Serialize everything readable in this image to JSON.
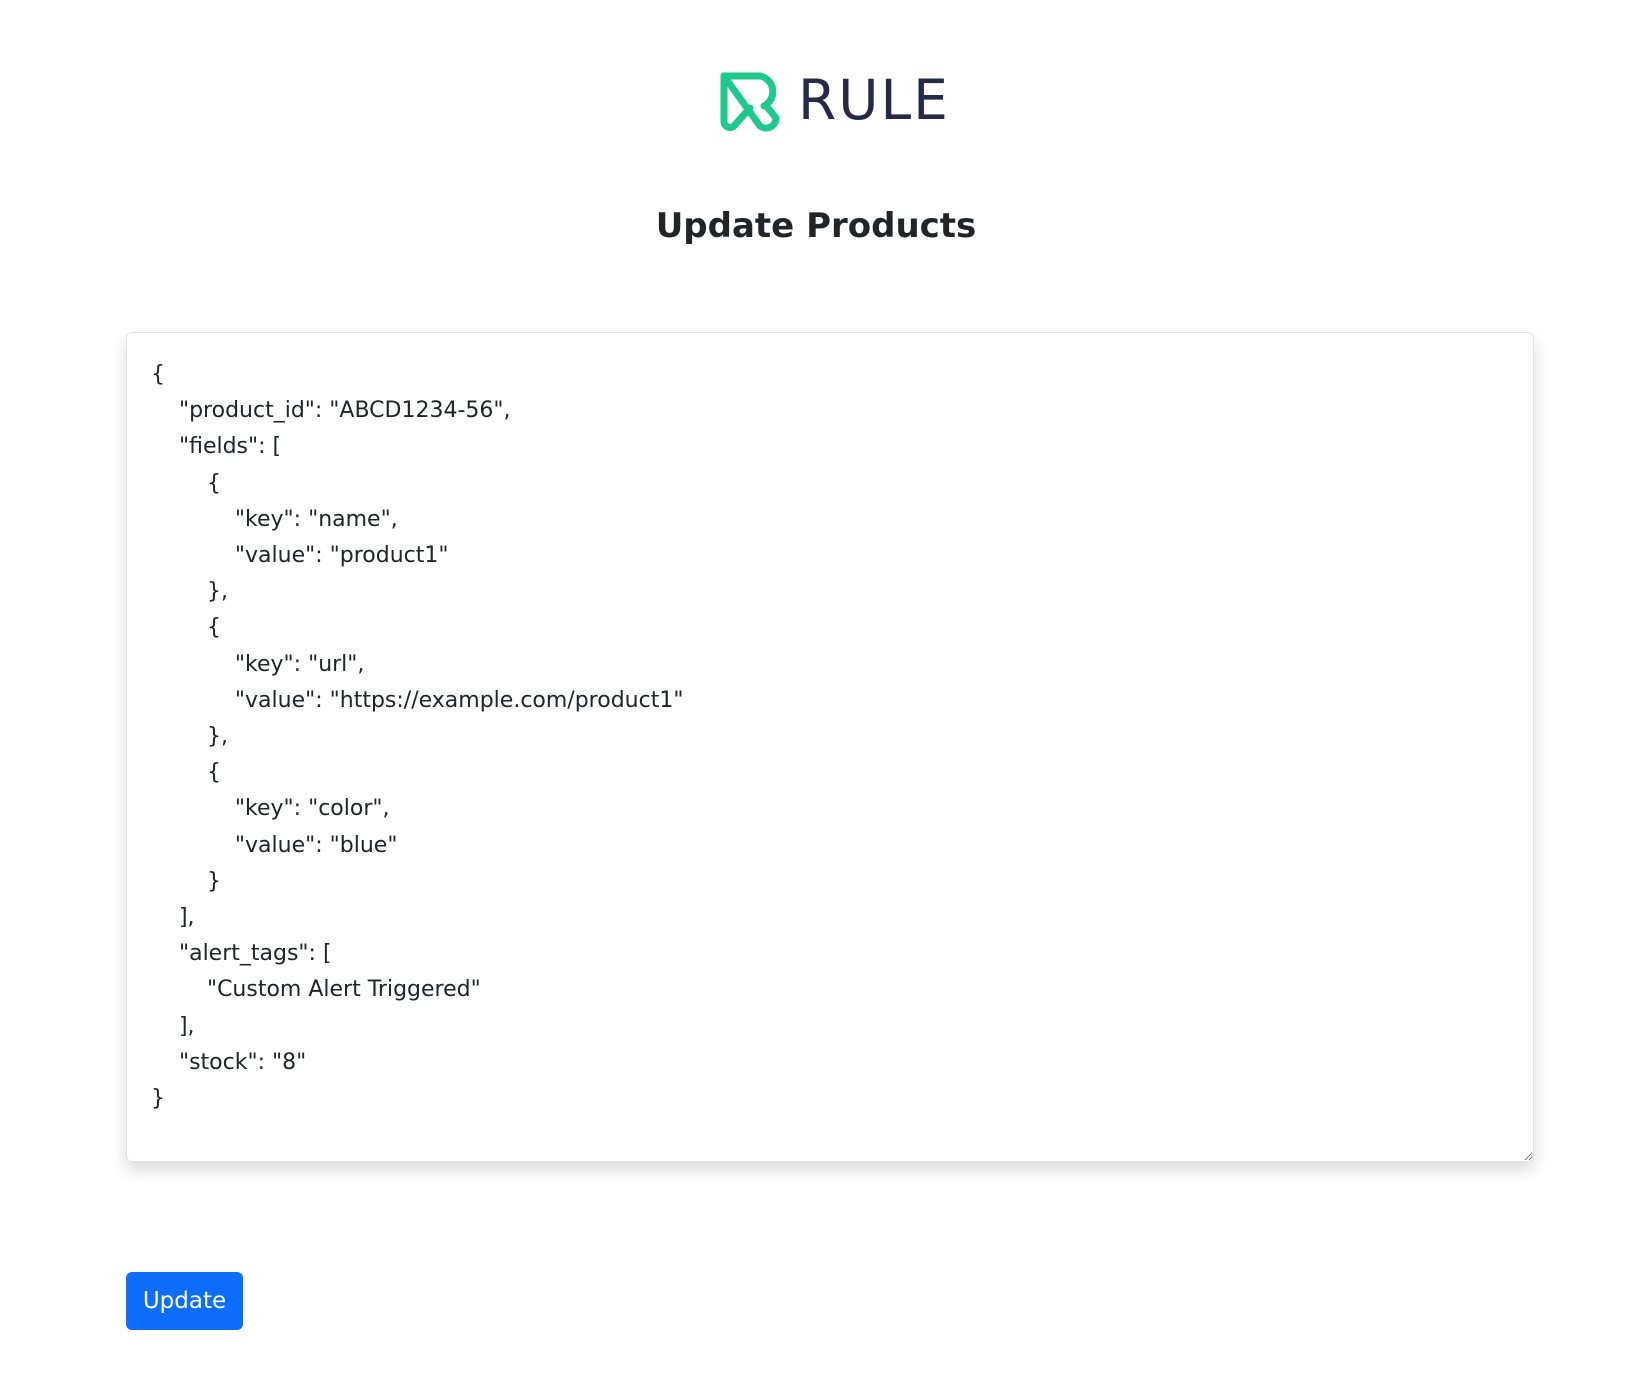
{
  "logo": {
    "text": "RULE",
    "icon": "rule-logo-mark-icon",
    "mark_color": "#1fc98e",
    "text_color": "#252a48"
  },
  "page": {
    "title": "Update Products"
  },
  "editor": {
    "value": "{\n    \"product_id\": \"ABCD1234-56\",\n    \"fields\": [\n        {\n            \"key\": \"name\",\n            \"value\": \"product1\"\n        },\n        {\n            \"key\": \"url\",\n            \"value\": \"https://example.com/product1\"\n        },\n        {\n            \"key\": \"color\",\n            \"value\": \"blue\"\n        }\n    ],\n    \"alert_tags\": [\n        \"Custom Alert Triggered\"\n    ],\n    \"stock\": \"8\"\n}"
  },
  "actions": {
    "update_label": "Update",
    "button_color": "#0d6efd"
  }
}
